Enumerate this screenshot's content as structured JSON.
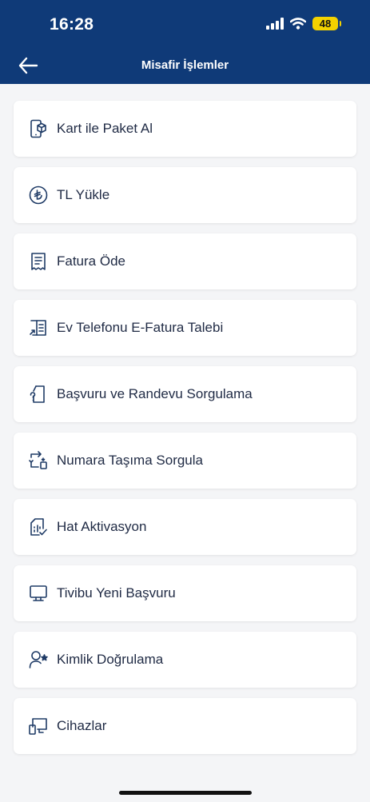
{
  "status_bar": {
    "time": "16:28",
    "battery": "48"
  },
  "header": {
    "title": "Misafir İşlemler",
    "back_icon": "arrow-left-icon"
  },
  "menu": {
    "items": [
      {
        "label": "Kart ile Paket Al",
        "icon": "card-package-icon"
      },
      {
        "label": "TL Yükle",
        "icon": "lira-circle-icon"
      },
      {
        "label": "Fatura Öde",
        "icon": "invoice-icon"
      },
      {
        "label": "Ev Telefonu E-Fatura Talebi",
        "icon": "e-invoice-icon"
      },
      {
        "label": "Başvuru ve Randevu Sorgulama",
        "icon": "document-question-icon"
      },
      {
        "label": "Numara Taşıma Sorgula",
        "icon": "number-transfer-icon"
      },
      {
        "label": "Hat Aktivasyon",
        "icon": "sim-activation-icon"
      },
      {
        "label": "Tivibu Yeni Başvuru",
        "icon": "monitor-icon"
      },
      {
        "label": "Kimlik Doğrulama",
        "icon": "user-verify-icon"
      },
      {
        "label": "Cihazlar",
        "icon": "devices-icon"
      }
    ]
  },
  "colors": {
    "header": "#0f3a78",
    "background": "#f4f5f7",
    "text": "#1f2a44",
    "icon": "#1f3b66"
  }
}
